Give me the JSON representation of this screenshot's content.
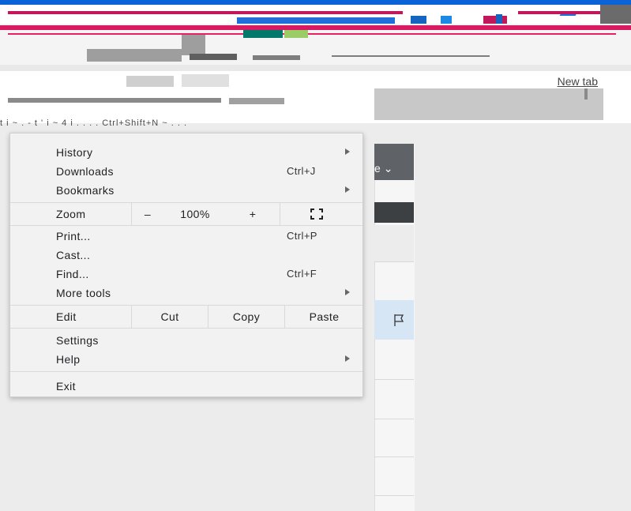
{
  "browser": {
    "new_tab_label": "New tab",
    "hint_text": "t i ~ . - t  ' i  ~ 4 i . . . . Ctrl+Shift+N ~ . . ."
  },
  "page": {
    "dropdown_fragment": "e"
  },
  "menu": {
    "items_top": [
      {
        "label": "History",
        "has_submenu": true
      },
      {
        "label": "Downloads",
        "shortcut": "Ctrl+J"
      },
      {
        "label": "Bookmarks",
        "has_submenu": true
      }
    ],
    "zoom": {
      "label": "Zoom",
      "minus": "–",
      "value": "100%",
      "plus": "+",
      "fullscreen_icon": "fullscreen-icon"
    },
    "items_mid": [
      {
        "label": "Print...",
        "shortcut": "Ctrl+P"
      },
      {
        "label": "Cast..."
      },
      {
        "label": "Find...",
        "shortcut": "Ctrl+F"
      },
      {
        "label": "More tools",
        "has_submenu": true
      }
    ],
    "edit": {
      "label": "Edit",
      "cut": "Cut",
      "copy": "Copy",
      "paste": "Paste"
    },
    "items_bottom": [
      {
        "label": "Settings"
      },
      {
        "label": "Help",
        "has_submenu": true
      }
    ],
    "exit": {
      "label": "Exit"
    }
  },
  "colors": {
    "menu_bg": "#f2f2f2",
    "selected_row": "#d6e6f5",
    "titlebar_accent": "#0a64d8"
  }
}
